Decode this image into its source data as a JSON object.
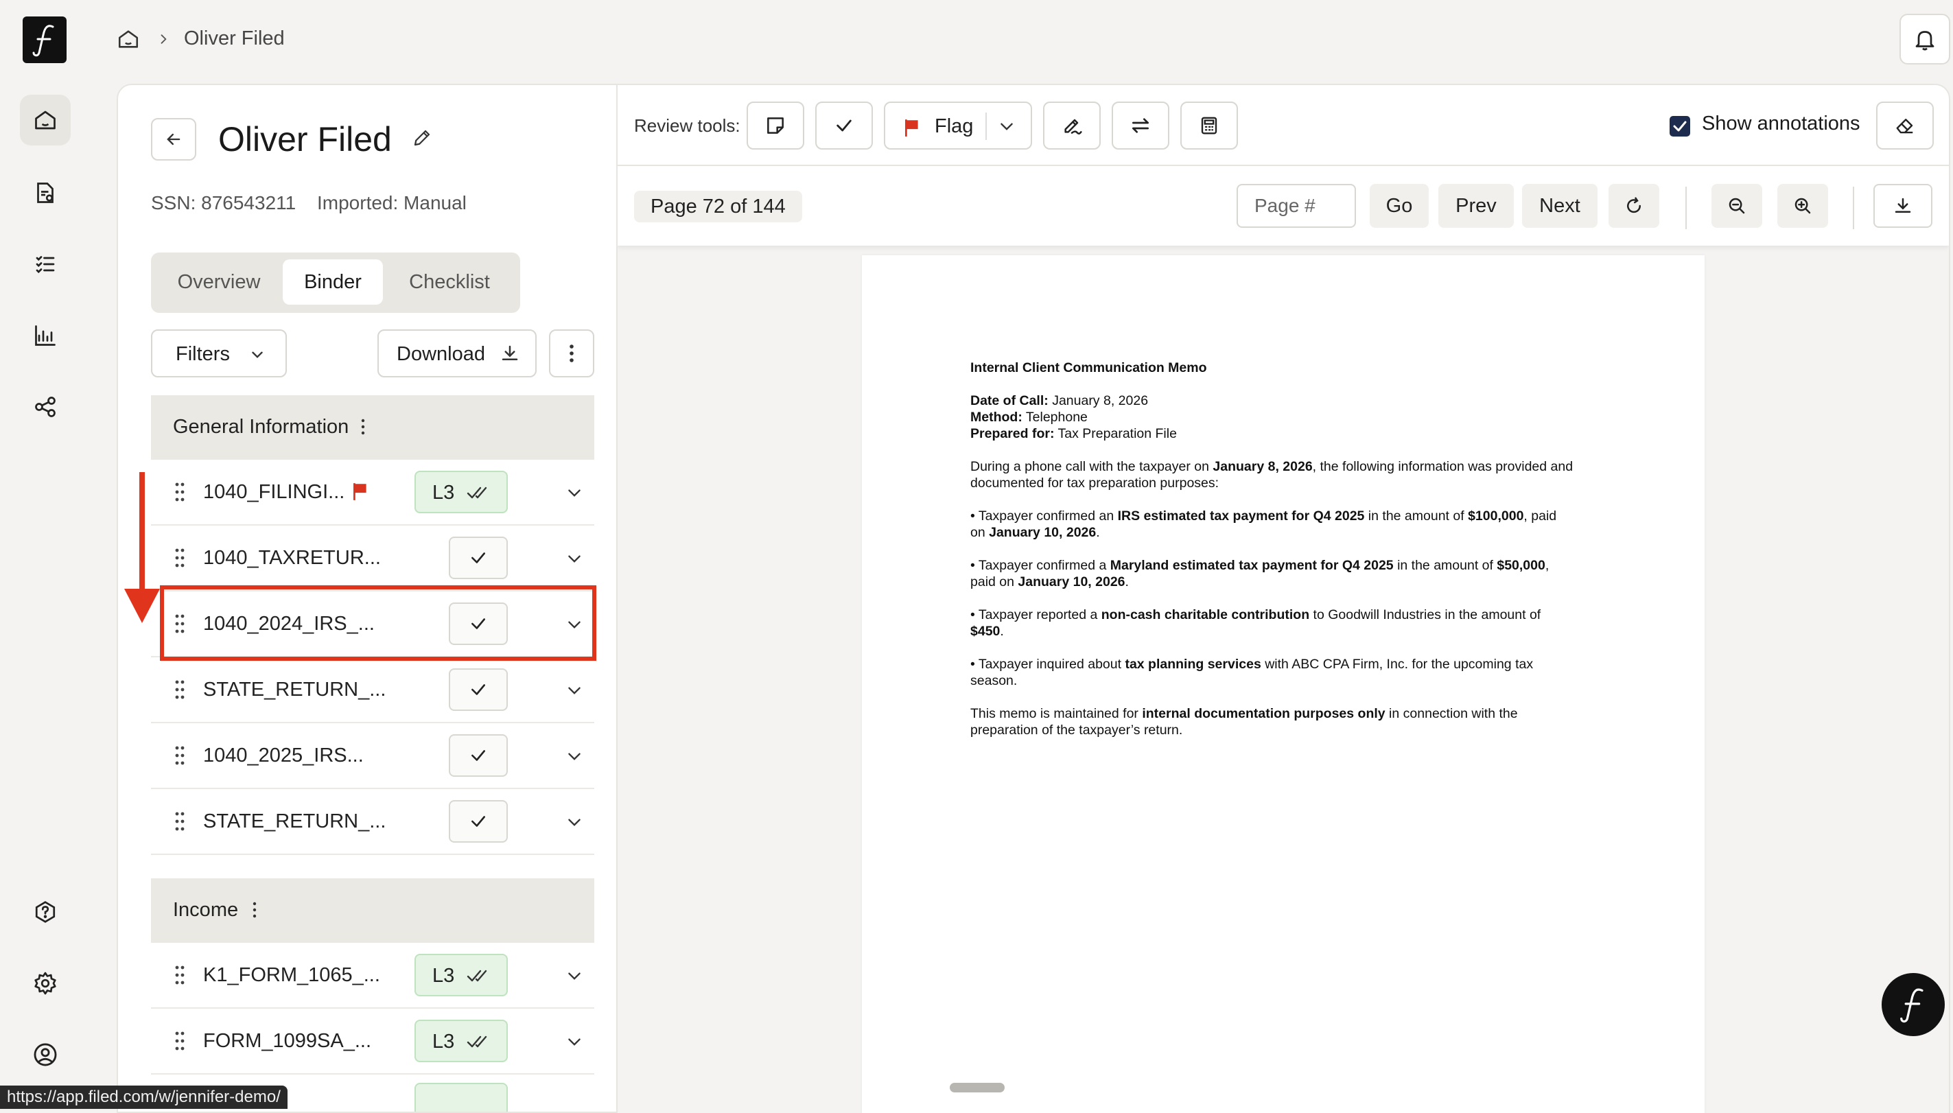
{
  "breadcrumb": {
    "current": "Oliver Filed"
  },
  "client": {
    "name": "Oliver Filed",
    "ssn": "SSN: 876543211",
    "imported": "Imported: Manual"
  },
  "tabs": [
    {
      "label": "Overview"
    },
    {
      "label": "Binder",
      "selected": true
    },
    {
      "label": "Checklist"
    }
  ],
  "controls": {
    "filters_label": "Filters",
    "download_label": "Download"
  },
  "sections": [
    {
      "label": "General Information",
      "rows": [
        {
          "name": "1040_FILINGI...",
          "status": "L3",
          "flagged": true
        },
        {
          "name": "1040_TAXRETUR...",
          "status": "check"
        },
        {
          "name": "1040_2024_IRS_...",
          "status": "check",
          "highlighted": true
        },
        {
          "name": "STATE_RETURN_...",
          "status": "check"
        },
        {
          "name": "1040_2025_IRS...",
          "status": "check"
        },
        {
          "name": "STATE_RETURN_...",
          "status": "check"
        }
      ]
    },
    {
      "label": "Income",
      "rows": [
        {
          "name": "K1_FORM_1065_...",
          "status": "L3"
        },
        {
          "name": "FORM_1099SA_...",
          "status": "L3"
        }
      ]
    }
  ],
  "viewer": {
    "review_tools_label": "Review tools:",
    "flag_label": "Flag",
    "show_annotations_label": "Show annotations",
    "show_annotations_checked": true,
    "page_indicator": "Page 72 of 144",
    "page_input_placeholder": "Page #",
    "go_label": "Go",
    "prev_label": "Prev",
    "next_label": "Next"
  },
  "document": {
    "title": "Internal Client Communication Memo",
    "date_label": "Date of Call:",
    "date_value": "January 8, 2026",
    "method_label": "Method:",
    "method_value": "Telephone",
    "prepared_label": "Prepared for:",
    "prepared_value": "Tax Preparation File",
    "intro_1": "During a phone call with the taxpayer on ",
    "intro_date": "January 8, 2026",
    "intro_2": ", the following information was provided and documented for tax preparation purposes:",
    "b1_1": "• Taxpayer confirmed an ",
    "b1_bold": "IRS estimated tax payment for Q4 2025",
    "b1_2": " in the amount of ",
    "b1_amt": "$100,000",
    "b1_3": ", paid on ",
    "b1_date": "January 10, 2026",
    "b1_4": ".",
    "b2_1": "• Taxpayer confirmed a ",
    "b2_bold": "Maryland estimated tax payment for Q4 2025",
    "b2_2": " in the amount of ",
    "b2_amt": "$50,000",
    "b2_3": ", paid on ",
    "b2_date": "January 10, 2026",
    "b2_4": ".",
    "b3_1": "• Taxpayer reported a ",
    "b3_bold": "non-cash charitable contribution",
    "b3_2": " to Goodwill Industries in the amount of ",
    "b3_amt": "$450",
    "b3_3": ".",
    "b4_1": "• Taxpayer inquired about ",
    "b4_bold": "tax planning services",
    "b4_2": " with ABC CPA Firm, Inc. for the upcoming tax season.",
    "c_1": "This memo is maintained for ",
    "c_bold": "internal documentation purposes only",
    "c_2": " in connection with the preparation of the taxpayer’s return."
  },
  "status_bar": {
    "url": "https://app.filed.com/w/jennifer-demo/"
  },
  "icons": {
    "logo": "filed-logo-icon",
    "home": "home-icon",
    "tasks": "file-list-icon",
    "checklist": "checklist-icon",
    "analytics": "chart-icon",
    "share": "share-icon",
    "help": "help-icon",
    "settings": "gear-icon",
    "account": "user-circle-icon",
    "bell": "bell-icon"
  },
  "colors": {
    "accent_red": "#e0341c",
    "l3_badge_bg": "#e6f4e6",
    "dark": "#111111"
  }
}
